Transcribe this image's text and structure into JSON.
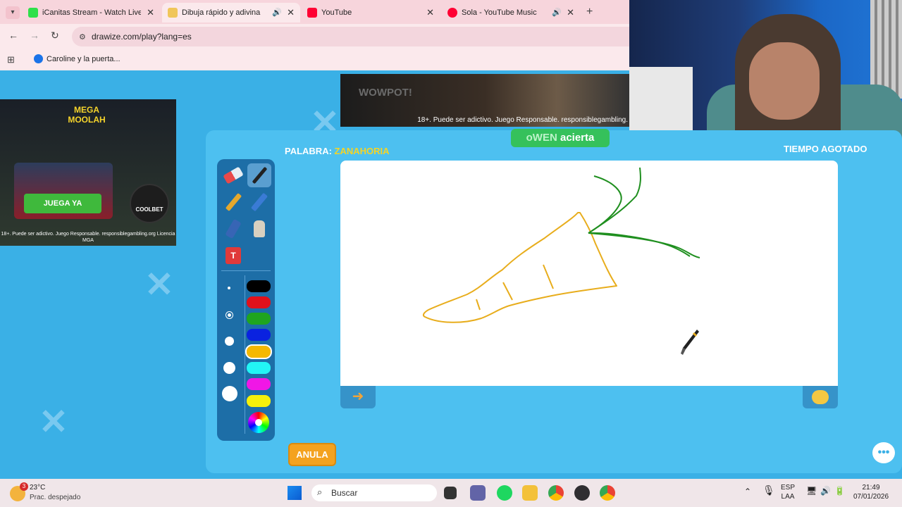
{
  "browser": {
    "tabs": [
      {
        "title": "iCanitas Stream - Watch Live on",
        "favicon_color": "#2ee04a"
      },
      {
        "title": "Dibuja rápido y adivina",
        "favicon_color": "#f0c65a",
        "audio": true
      },
      {
        "title": "YouTube",
        "favicon_color": "#ff0033"
      },
      {
        "title": "Sola - YouTube Music",
        "favicon_color": "#ff0033",
        "audio": true
      }
    ],
    "url": "drawize.com/play?lang=es",
    "bookmarks": [
      {
        "label": "Caroline y la puerta..."
      }
    ]
  },
  "ads": {
    "left": {
      "logo_text": "MEGA MOOLAH",
      "cta": "JUEGA YA",
      "badge": "COOLBET",
      "disclaimer": "18+. Puede ser adictivo. Juego Responsable. responsiblegambling.org Licencia MGA"
    },
    "top": {
      "brand": "WOWPOT!",
      "disclaimer": "18+. Puede ser adictivo. Juego Responsable. responsiblegambling."
    }
  },
  "game": {
    "word_label": "PALABRA:",
    "word_value": "ZANAHORIA",
    "notice_player": "oWEN",
    "notice_action": "acierta",
    "timer_text": "TIEMPO AGOTADO",
    "anula_label": "ANULA",
    "tools": [
      "eraser",
      "brush",
      "pencil",
      "marker",
      "spray",
      "hand",
      "fill"
    ],
    "active_tool": "brush",
    "colors": [
      "#000000",
      "#e0111b",
      "#1fa51f",
      "#0a22e0",
      "#f5b800",
      "#22f5f5",
      "#f017e6",
      "#f5f00a"
    ],
    "active_color": "#f5b800",
    "brush_sizes": [
      1,
      2,
      3,
      4,
      5
    ],
    "active_size": 2,
    "palette_colors": {
      "panel": "#1d6ea7",
      "canvas": "#ffffff",
      "accent": "#f4a21f"
    }
  },
  "taskbar": {
    "weather_temp": "23°C",
    "weather_desc": "Prac. despejado",
    "weather_badge": "3",
    "search_placeholder": "Buscar",
    "lang_top": "ESP",
    "lang_bottom": "LAA",
    "time": "21:49",
    "date": "07/01/2026"
  }
}
